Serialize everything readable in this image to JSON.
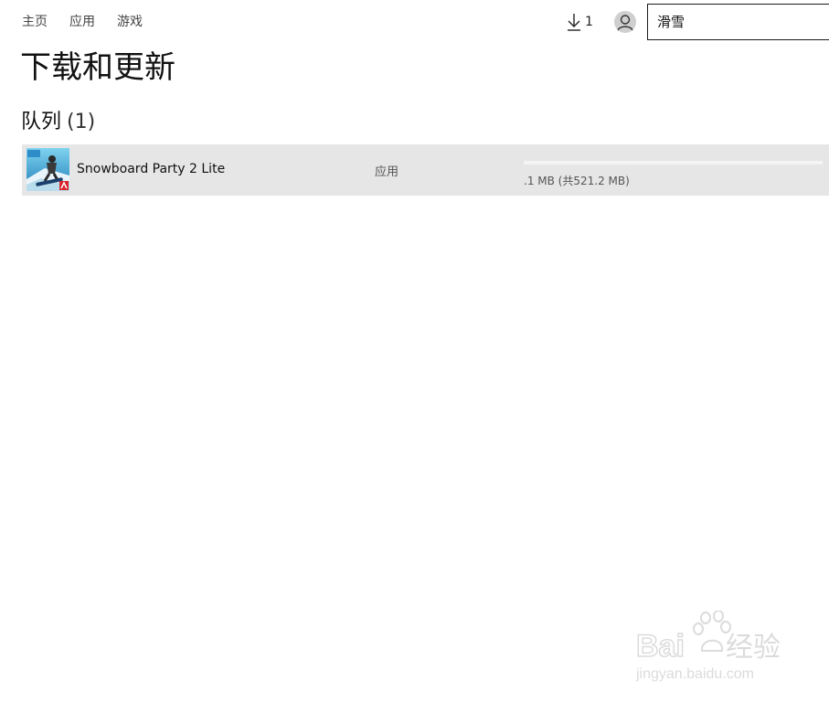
{
  "nav": {
    "items": [
      "主页",
      "应用",
      "游戏"
    ]
  },
  "header": {
    "download_count": "1",
    "search_value": "滑雪"
  },
  "page": {
    "title": "下载和更新",
    "section_label": "队列",
    "section_count": "(1)"
  },
  "queue": [
    {
      "name": "Snowboard Party 2 Lite",
      "type": "应用",
      "progress_text": ".1 MB (共521.2 MB)",
      "progress_fraction": 0.0002,
      "icon": "snowboard-app-icon"
    }
  ],
  "watermark": {
    "brand": "Bai du 经验",
    "url": "jingyan.baidu.com"
  },
  "colors": {
    "row_bg": "#e6e6e6",
    "accent": "#0063b1"
  }
}
